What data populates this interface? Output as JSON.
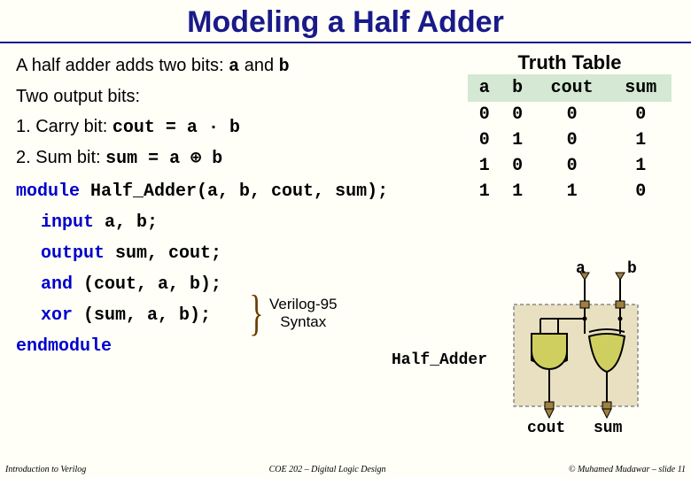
{
  "title": "Modeling a Half Adder",
  "desc_prefix": "A half adder adds two bits: ",
  "desc_a": "a",
  "desc_and": " and ",
  "desc_b": "b",
  "two_out": "Two output bits:",
  "step1_prefix": "1. Carry bit: ",
  "step1_code": "cout = a · b",
  "step2_prefix": "2. Sum bit: ",
  "step2_code": "sum = a ⊕ b",
  "tt_title": "Truth Table",
  "tt_headers": [
    "a",
    "b",
    "cout",
    "sum"
  ],
  "tt_rows": [
    [
      "0",
      "0",
      "0",
      "0"
    ],
    [
      "0",
      "1",
      "0",
      "1"
    ],
    [
      "1",
      "0",
      "0",
      "1"
    ],
    [
      "1",
      "1",
      "1",
      "0"
    ]
  ],
  "chart_data": {
    "type": "table",
    "title": "Truth Table",
    "columns": [
      "a",
      "b",
      "cout",
      "sum"
    ],
    "rows": [
      [
        0,
        0,
        0,
        0
      ],
      [
        0,
        1,
        0,
        1
      ],
      [
        1,
        0,
        0,
        1
      ],
      [
        1,
        1,
        1,
        0
      ]
    ]
  },
  "code": {
    "l1a": "module",
    "l1b": " Half_Adder(a, b, cout, sum);",
    "l2a": "input",
    "l2b": " a, b;",
    "l3a": "output",
    "l3b": " sum, cout;",
    "l4a": "and",
    "l4b": " (cout, a, b);",
    "l5a": "xor",
    "l5b": " (sum, a, b);",
    "l6": "endmodule"
  },
  "syntax_note_l1": "Verilog-95",
  "syntax_note_l2": "Syntax",
  "diag": {
    "a": "a",
    "b": "b",
    "module_label": "Half_Adder",
    "cout": "cout",
    "sum": "sum"
  },
  "footer_left": "Introduction to Verilog",
  "footer_center": "COE 202 – Digital Logic Design",
  "footer_right": "© Muhamed Mudawar – slide 11"
}
